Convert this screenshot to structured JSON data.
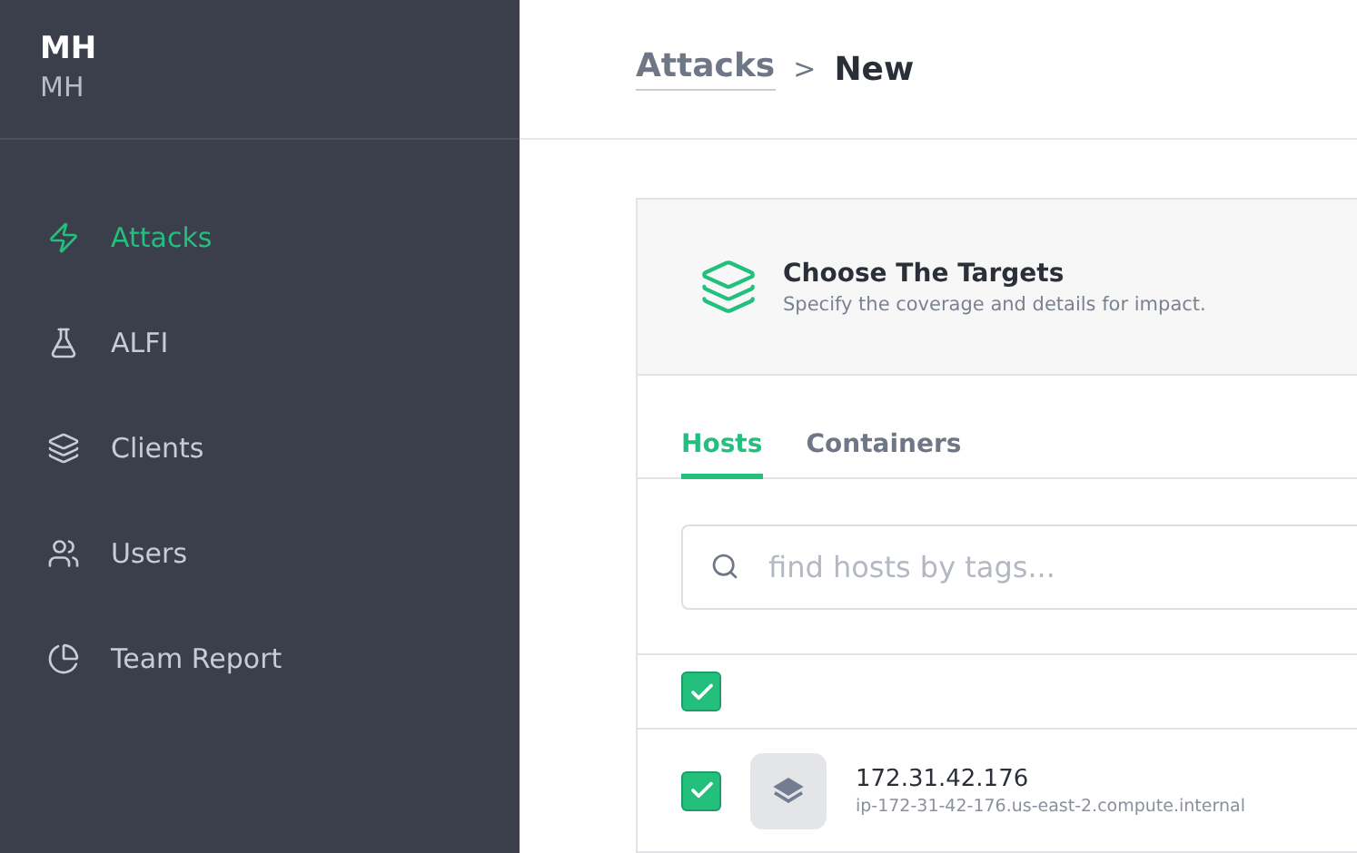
{
  "account": {
    "name": "MH",
    "subtitle": "MH"
  },
  "sidebar": {
    "items": [
      {
        "kind": "bolt",
        "label": "Attacks",
        "selected": true
      },
      {
        "kind": "flask",
        "label": "ALFI",
        "selected": false
      },
      {
        "kind": "layers",
        "label": "Clients",
        "selected": false
      },
      {
        "kind": "users",
        "label": "Users",
        "selected": false
      },
      {
        "kind": "report",
        "label": "Team Report",
        "selected": false
      }
    ]
  },
  "breadcrumb": {
    "parent": "Attacks",
    "separator": ">",
    "current": "New"
  },
  "card": {
    "title": "Choose The Targets",
    "subtitle": "Specify the coverage and details for impact.",
    "tabs": [
      {
        "label": "Hosts",
        "selected": true
      },
      {
        "label": "Containers",
        "selected": false
      }
    ],
    "search": {
      "placeholder": "find hosts by tags..."
    },
    "select_all": {
      "checked": true
    },
    "hosts": [
      {
        "checked": true,
        "address": "172.31.42.176",
        "hostname": "ip-172-31-42-176.us-east-2.compute.internal"
      }
    ]
  }
}
